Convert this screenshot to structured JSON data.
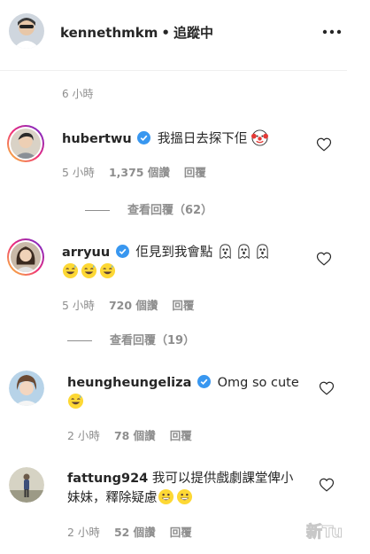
{
  "header": {
    "username": "kennethmkm",
    "separator": "•",
    "follow_status": "追蹤中",
    "more_icon": "more-horizontal-icon"
  },
  "post": {
    "time": "6 小時"
  },
  "comments": [
    {
      "username": "hubertwu",
      "verified": true,
      "text": "我搵日去探下佢",
      "emojis": [
        "clown-face"
      ],
      "time": "5 小時",
      "likes": "1,375 個讚",
      "reply_label": "回覆",
      "view_replies": "查看回覆（62）"
    },
    {
      "username": "arryuu",
      "verified": true,
      "text": "佢見到我會點",
      "emojis": [
        "ghost",
        "ghost",
        "ghost",
        "grinning-sweat",
        "grinning-sweat",
        "grinning-sweat"
      ],
      "time": "5 小時",
      "likes": "720 個讚",
      "reply_label": "回覆",
      "view_replies": "查看回覆（19）"
    },
    {
      "username": "heungheungeliza",
      "verified": true,
      "text": "Omg so cute",
      "emojis": [
        "grinning-sweat"
      ],
      "time": "2 小時",
      "likes": "78 個讚",
      "reply_label": "回覆"
    },
    {
      "username": "fattung924",
      "verified": false,
      "text": "我可以提供戲劇課堂俾小妹妹，釋除疑慮",
      "emojis": [
        "grinning-smile",
        "grinning-smile"
      ],
      "time": "2 小時",
      "likes": "52 個讚",
      "reply_label": "回覆"
    }
  ],
  "watermark": "新Tu",
  "colors": {
    "text": "#262626",
    "secondary": "#8e8e8e",
    "verified": "#3897f0"
  }
}
